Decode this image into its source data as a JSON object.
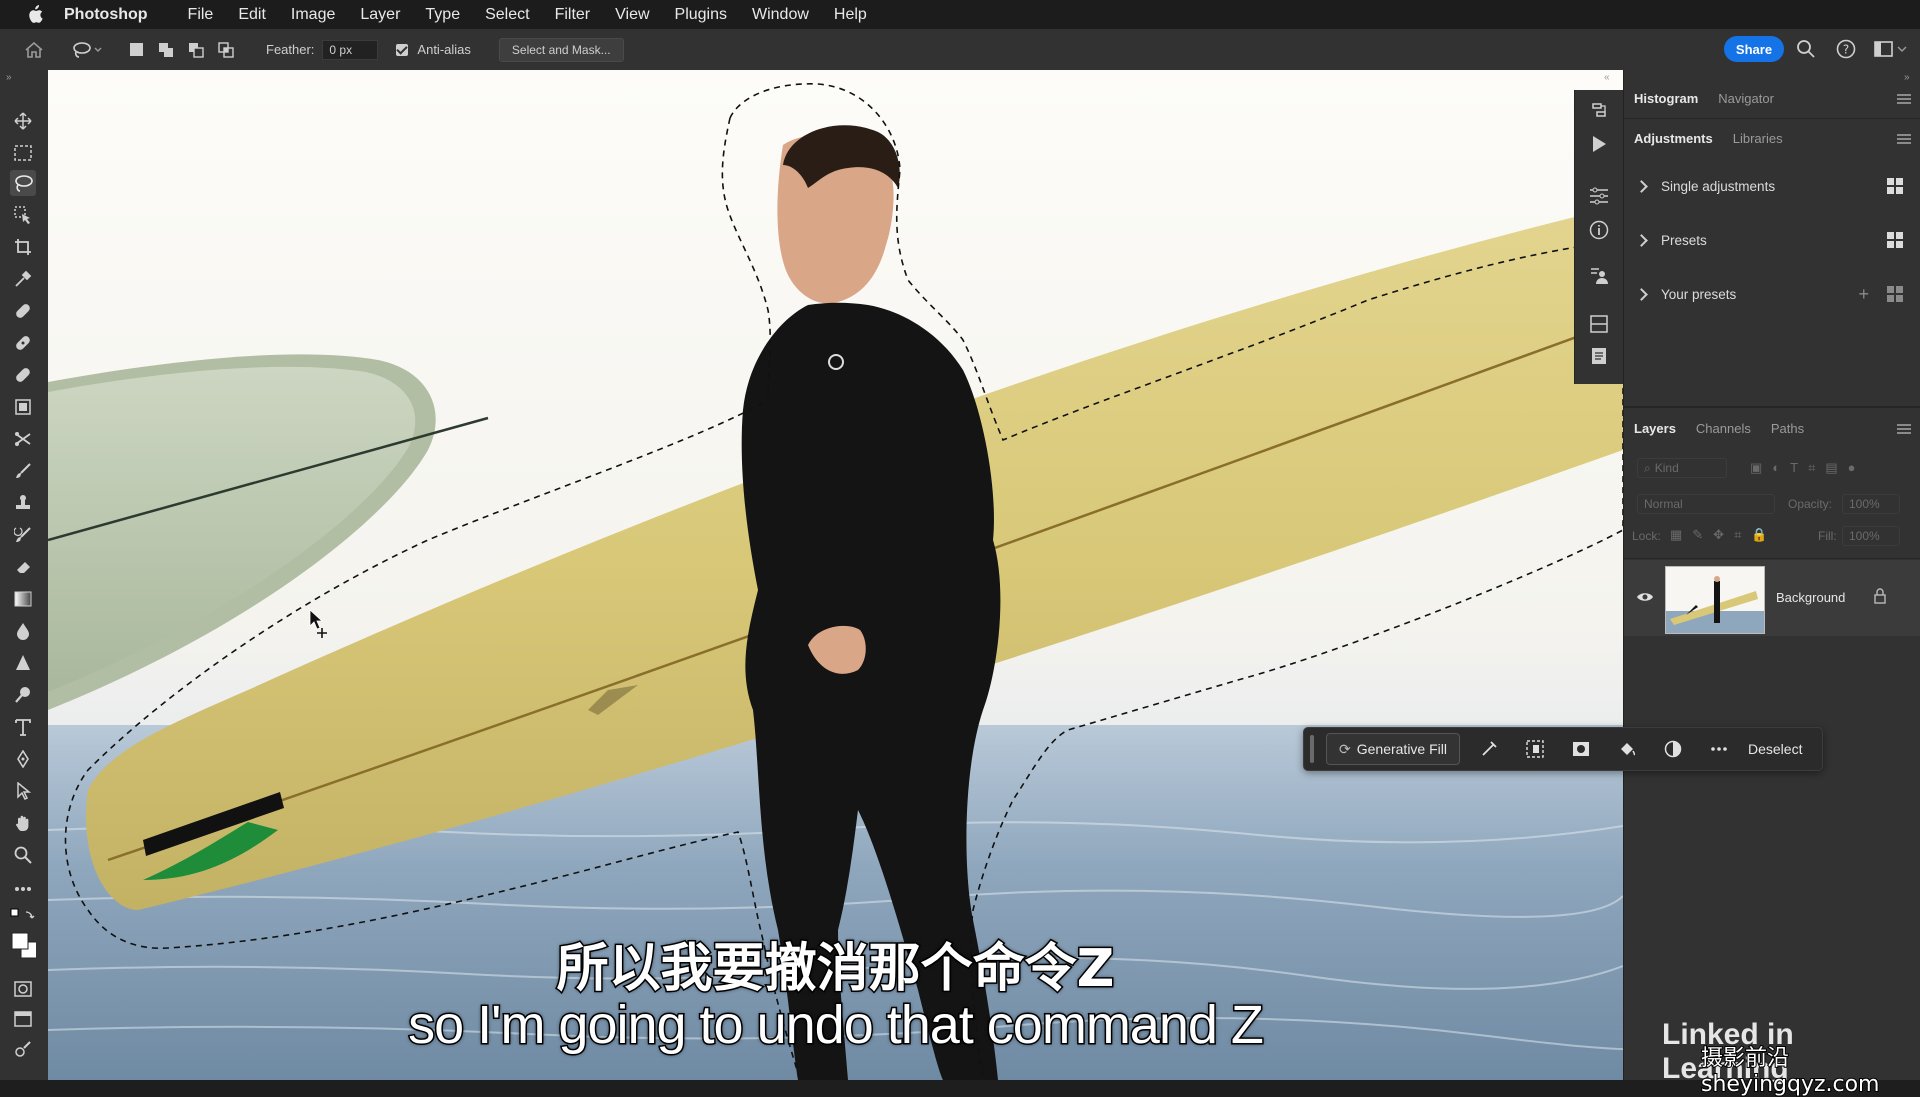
{
  "menubar": {
    "app_name": "Photoshop",
    "items": [
      "File",
      "Edit",
      "Image",
      "Layer",
      "Type",
      "Select",
      "Filter",
      "View",
      "Plugins",
      "Window",
      "Help"
    ]
  },
  "options_bar": {
    "feather_label": "Feather:",
    "feather_value": "0 px",
    "antialias_label": "Anti-alias",
    "select_mask_label": "Select and Mask...",
    "share_label": "Share"
  },
  "panels": {
    "top_tabs": [
      "Histogram",
      "Navigator"
    ],
    "adj_tabs": [
      "Adjustments",
      "Libraries"
    ],
    "adjustments": [
      "Single adjustments",
      "Presets",
      "Your presets"
    ],
    "layer_tabs": [
      "Layers",
      "Channels",
      "Paths"
    ],
    "kind_placeholder": "Kind",
    "blend_mode": "Normal",
    "opacity_label": "Opacity:",
    "opacity_value": "100%",
    "lock_label": "Lock:",
    "fill_label": "Fill:",
    "fill_value": "100%",
    "layer_name": "Background"
  },
  "taskbar": {
    "generative_fill": "Generative Fill",
    "deselect": "Deselect"
  },
  "subtitles": {
    "chinese": "所以我要撤消那个命令Z",
    "english": "so I'm going to undo that command Z"
  },
  "branding": {
    "linkedin": "Linked in Learning",
    "watermark": "摄影前沿 sheyingqyz.com"
  },
  "colors": {
    "accent": "#1473e6",
    "panel_bg": "#323232",
    "menubar_bg": "#1c1c1c"
  }
}
